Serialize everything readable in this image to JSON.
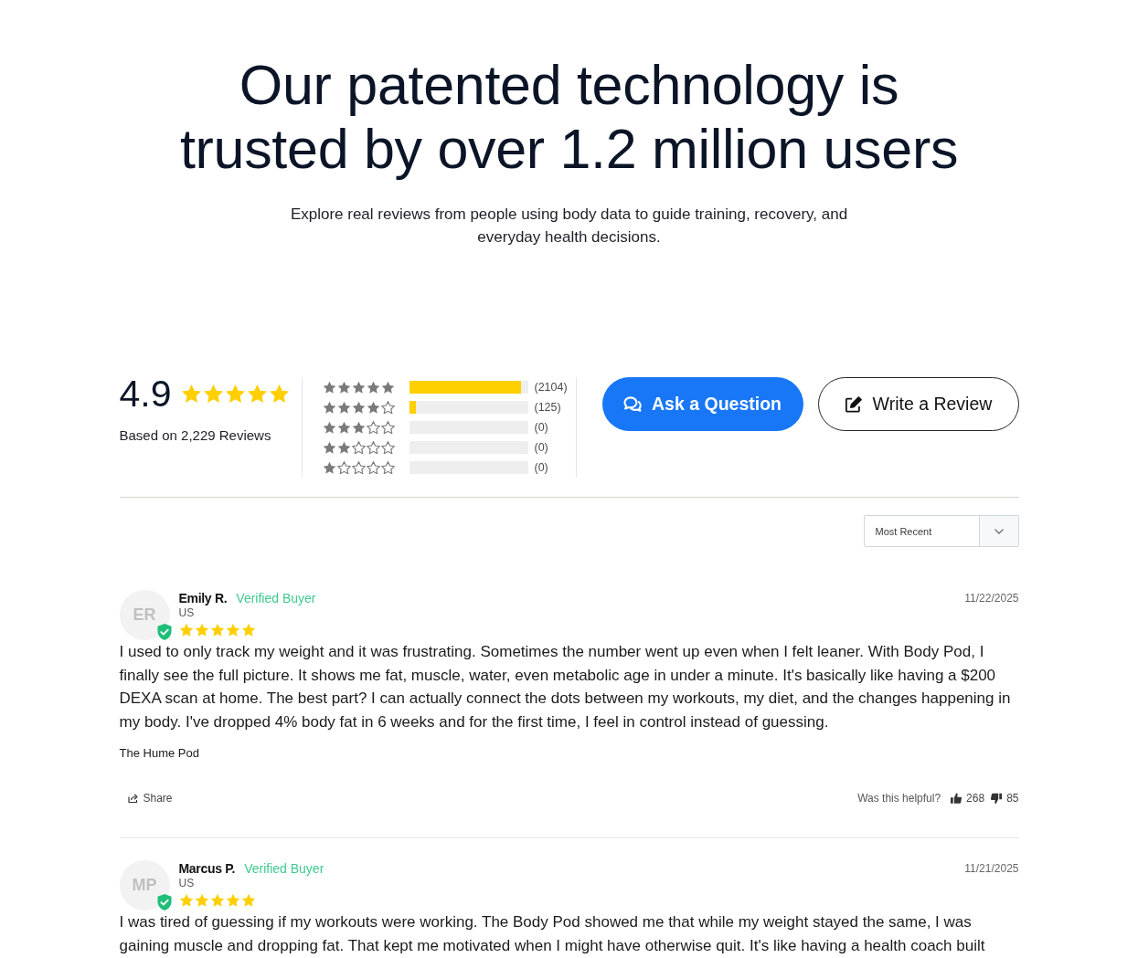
{
  "heading": "Our patented technology is trusted by over 1.2 million users",
  "subtitle": "Explore real reviews from people using body data to guide training, recovery, and everyday health decisions.",
  "summary": {
    "average": "4.9",
    "stars": 5,
    "based_on": "Based on 2,229 Reviews"
  },
  "histogram": [
    {
      "stars": 5,
      "level": 0.944,
      "count": "(2104)"
    },
    {
      "stars": 4,
      "level": 0.056,
      "count": "(125)"
    },
    {
      "stars": 3,
      "level": 0,
      "count": "(0)"
    },
    {
      "stars": 2,
      "level": 0,
      "count": "(0)"
    },
    {
      "stars": 1,
      "level": 0,
      "count": "(0)"
    }
  ],
  "actions": [
    {
      "kind": "ask",
      "label": "Ask a Question"
    },
    {
      "kind": "write",
      "label": "Write a Review"
    }
  ],
  "sort": {
    "value": "Most Recent"
  },
  "reviews": [
    {
      "initials": "ER",
      "verified": true,
      "name": "Emily R.",
      "badge": "Verified Buyer",
      "location": "US",
      "stars": 5,
      "date": "11/22/2025",
      "body": "I used to only track my weight and it was frustrating. Sometimes the number went up even when I felt leaner. With Body Pod, I finally see the full picture. It shows me fat, muscle, water, even metabolic age in under a minute. It's basically like having a $200 DEXA scan at home. The best part? I can actually connect the dots between my workouts, my diet, and the changes happening in my body. I've dropped 4% body fat in 6 weeks and for the first time, I feel in control instead of guessing.",
      "product": "The Hume Pod",
      "share": "Share",
      "helpful_prompt": "Was this helpful?",
      "upvotes": "268",
      "downvotes": "85"
    },
    {
      "initials": "MP",
      "verified": true,
      "name": "Marcus P.",
      "badge": "Verified Buyer",
      "location": "US",
      "stars": 5,
      "date": "11/21/2025",
      "body": "I was tired of guessing if my workouts were working. The Body Pod showed me that while my weight stayed the same, I was gaining muscle and dropping fat. That kept me motivated when I might have otherwise quit. It's like having a health coach built"
    }
  ]
}
